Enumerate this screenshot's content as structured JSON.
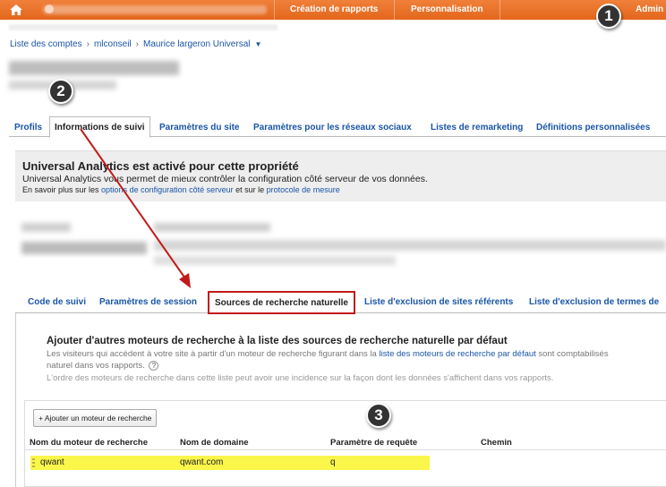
{
  "topbar": {
    "tabs": [
      "Création de rapports",
      "Personnalisation",
      "Admin"
    ],
    "accent": "#e8702a"
  },
  "badges": [
    "1",
    "2",
    "3"
  ],
  "breadcrumb": [
    "Liste des comptes",
    "mlconseil",
    "Maurice largeron Universal"
  ],
  "property_tabs": [
    "Profils",
    "Informations de suivi",
    "Paramètres du site",
    "Paramètres pour les réseaux sociaux",
    "Listes de remarketing",
    "Définitions personnalisées"
  ],
  "ua_panel": {
    "title": "Universal Analytics est activé pour cette propriété",
    "text": "Universal Analytics vous permet de mieux contrôler la configuration côté serveur de vos données.",
    "more_prefix": "En savoir plus sur les ",
    "link1": "options de configuration côté serveur",
    "more_middle": " et sur le ",
    "link2": "protocole de mesure"
  },
  "tracking_tabs": [
    "Code de suivi",
    "Paramètres de session",
    "Sources de recherche naturelle",
    "Liste d'exclusion de sites référents",
    "Liste d'exclusion de termes de"
  ],
  "section": {
    "title": "Ajouter d'autres moteurs de recherche à la liste des sources de recherche naturelle par défaut",
    "desc1_prefix": "Les visiteurs qui accèdent à votre site à partir d'un moteur de recherche figurant dans la ",
    "desc1_link": "liste des moteurs de recherche par défaut",
    "desc1_suffix": " sont comptabilisés",
    "desc2": "naturel dans vos rapports.",
    "help": "?",
    "desc3": "L'ordre des moteurs de recherche dans cette liste peut avoir une incidence sur la façon dont les données s'affichent dans vos rapports.",
    "add_button": "+ Ajouter un moteur de recherche"
  },
  "table": {
    "columns": [
      "Nom du moteur de recherche",
      "Nom de domaine",
      "Paramètre de requête",
      "Chemin"
    ],
    "rows": [
      [
        "qwant",
        "qwant.com",
        "q",
        ""
      ]
    ]
  }
}
